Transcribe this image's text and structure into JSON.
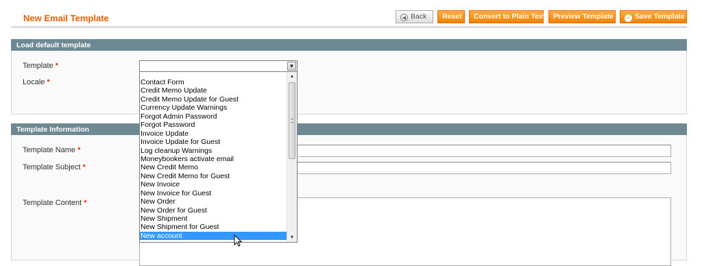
{
  "page": {
    "title": "New Email Template"
  },
  "toolbar": {
    "back_label": "Back",
    "reset_label": "Reset",
    "convert_label": "Convert to Plain Text",
    "preview_label": "Preview Template",
    "save_label": "Save Template"
  },
  "load_default": {
    "legend": "Load default template",
    "template_label": "Template",
    "locale_label": "Locale",
    "template_value": "",
    "options": [
      "Contact Form",
      "Credit Memo Update",
      "Credit Memo Update for Guest",
      "Currency Update Warnings",
      "Forgot Admin Password",
      "Forgot Password",
      "Invoice Update",
      "Invoice Update for Guest",
      "Log cleanup Warnings",
      "Moneybookers activate email",
      "New Credit Memo",
      "New Credit Memo for Guest",
      "New Invoice",
      "New Invoice for Guest",
      "New Order",
      "New Order for Guest",
      "New Shipment",
      "New Shipment for Guest",
      "New account"
    ],
    "highlighted_option": "New account"
  },
  "template_info": {
    "legend": "Template Information",
    "name_label": "Template Name",
    "subject_label": "Template Subject",
    "content_label": "Template Content",
    "name_value": "",
    "subject_value": "",
    "content_value": ""
  },
  "required_marker": "*",
  "icons": {
    "back": "back-arrow-icon",
    "save": "checkmark-icon",
    "select_arrow": "chevron-down-icon",
    "cursor": "mouse-pointer-icon"
  },
  "colors": {
    "accent": "#eb5e00",
    "button": "#f18200",
    "section_header": "#6f8992",
    "selected_option": "#3399ff"
  }
}
